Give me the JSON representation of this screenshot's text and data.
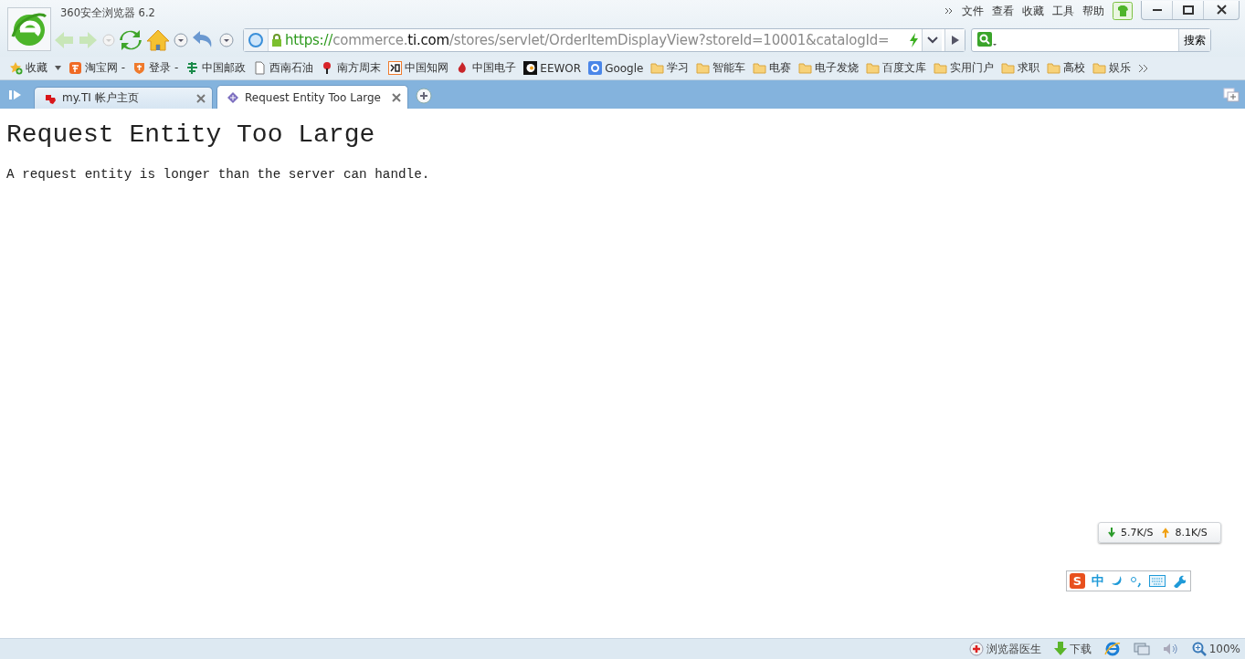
{
  "window": {
    "title": "360安全浏览器 6.2"
  },
  "menu": [
    "文件",
    "查看",
    "收藏",
    "工具",
    "帮助"
  ],
  "address": {
    "parts": [
      {
        "kind": "scheme",
        "text": "https://"
      },
      {
        "kind": "host",
        "text": "commerce."
      },
      {
        "kind": "domain",
        "text": "ti.com"
      },
      {
        "kind": "path",
        "text": "/stores/servlet/OrderItemDisplayView?storeId=10001&catalogId="
      }
    ]
  },
  "search": {
    "button": "搜索"
  },
  "bookmarks": [
    {
      "label": "收藏",
      "kind": "site",
      "menu": true
    },
    {
      "label": "淘宝网 -",
      "kind": "site",
      "menu": false
    },
    {
      "label": "登录 -",
      "kind": "site",
      "menu": false
    },
    {
      "label": "中国邮政",
      "kind": "site",
      "menu": false
    },
    {
      "label": "西南石油",
      "kind": "site",
      "menu": false
    },
    {
      "label": "南方周末",
      "kind": "site",
      "menu": false
    },
    {
      "label": "中国知网",
      "kind": "site",
      "menu": false
    },
    {
      "label": "中国电子",
      "kind": "site",
      "menu": false
    },
    {
      "label": "EEWOR",
      "kind": "site",
      "menu": false
    },
    {
      "label": "Google",
      "kind": "site",
      "menu": false
    },
    {
      "label": "学习",
      "kind": "folder",
      "menu": false
    },
    {
      "label": "智能车",
      "kind": "folder",
      "menu": false
    },
    {
      "label": "电赛",
      "kind": "folder",
      "menu": false
    },
    {
      "label": "电子发烧",
      "kind": "folder",
      "menu": false
    },
    {
      "label": "百度文库",
      "kind": "folder",
      "menu": false
    },
    {
      "label": "实用门户",
      "kind": "folder",
      "menu": false
    },
    {
      "label": "求职",
      "kind": "folder",
      "menu": false
    },
    {
      "label": "高校",
      "kind": "folder",
      "menu": false
    },
    {
      "label": "娱乐",
      "kind": "folder",
      "menu": false
    }
  ],
  "tabs": [
    {
      "label": "my.TI 帐户主页",
      "selected": false
    },
    {
      "label": "Request Entity Too Large",
      "selected": true
    }
  ],
  "page": {
    "heading": "Request Entity Too Large",
    "text": "A request entity is longer than the server can handle."
  },
  "speed": {
    "down": "5.7K/S",
    "up": "8.1K/S"
  },
  "ime": {
    "logo": "S",
    "mode": "中"
  },
  "status_bar": {
    "doctor": "浏览器医生",
    "download": "下载",
    "zoom": "100%"
  }
}
